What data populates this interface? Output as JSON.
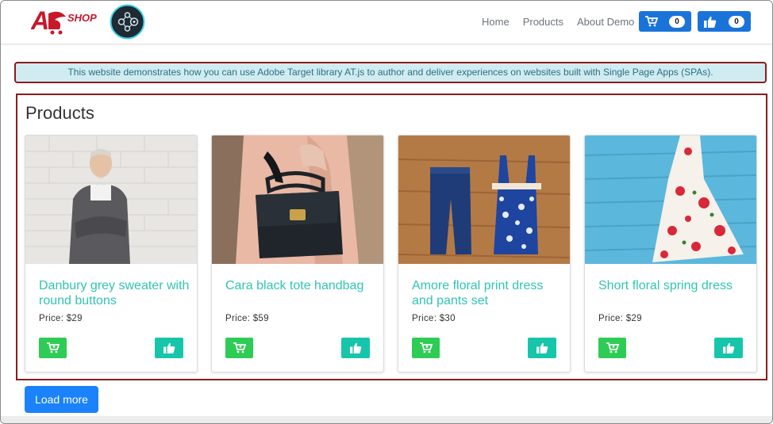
{
  "header": {
    "logo_text": "SHOP",
    "nav": [
      "Home",
      "Products",
      "About Demo"
    ],
    "cart_count": "0",
    "like_count": "0"
  },
  "banner": {
    "text": "This website demonstrates how you can use Adobe Target library AT.js to author and deliver experiences on websites built with Single Page Apps (SPAs)."
  },
  "products": {
    "title": "Products",
    "items": [
      {
        "name": "Danbury grey sweater with round buttons",
        "price": "Price: $29"
      },
      {
        "name": "Cara black tote handbag",
        "price": "Price: $59"
      },
      {
        "name": "Amore floral print dress and pants set",
        "price": "Price: $30"
      },
      {
        "name": "Short floral spring dress",
        "price": "Price: $29"
      }
    ]
  },
  "load_more_label": "Load more",
  "colors": {
    "primary": "#1a73d9",
    "cart_green": "#2ecc54",
    "like_teal": "#17c6aa",
    "title_teal": "#2fc5b4",
    "banner_bg": "#d1ecf1",
    "highlight_border": "#8b1c1c"
  }
}
